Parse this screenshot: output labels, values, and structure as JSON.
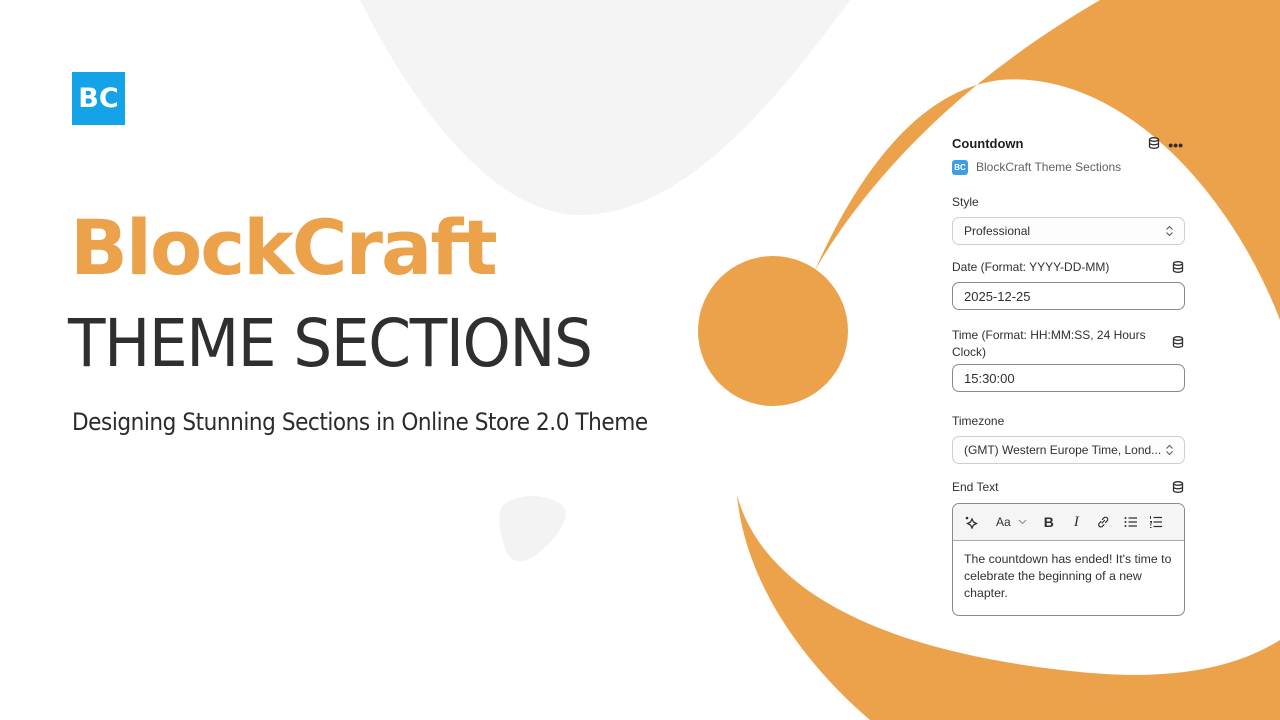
{
  "brand": {
    "logo_text": "BC",
    "title": "BlockCraft",
    "subtitle": "THEME SECTIONS",
    "tagline": "Designing Stunning Sections in Online Store 2.0 Theme",
    "colors": {
      "accent_orange": "#eca24b",
      "logo_blue": "#13a3e6",
      "soft_gray": "#f4f4f4",
      "text_dark": "#2f2f2f"
    }
  },
  "panel": {
    "title": "Countdown",
    "header_icons": [
      "database-icon",
      "more-icon"
    ],
    "app_badge": "BC",
    "app_name": "BlockCraft Theme Sections",
    "fields": {
      "style": {
        "label": "Style",
        "value": "Professional"
      },
      "date": {
        "label": "Date (Format: YYYY-DD-MM)",
        "value": "2025-12-25"
      },
      "time": {
        "label": "Time (Format: HH:MM:SS, 24 Hours Clock)",
        "value": "15:30:00"
      },
      "timezone": {
        "label": "Timezone",
        "value": "(GMT) Western Europe Time, Lond..."
      },
      "end_text": {
        "label": "End Text",
        "value": "The countdown has ended! It's time to celebrate the beginning of a new chapter.",
        "toolbar": {
          "magic": "sparkle-icon",
          "format_label": "Aa",
          "bold": "B",
          "italic": "I",
          "link": "link-icon",
          "bullet_list": "bullet-list-icon",
          "numbered_list": "numbered-list-icon"
        }
      }
    }
  }
}
